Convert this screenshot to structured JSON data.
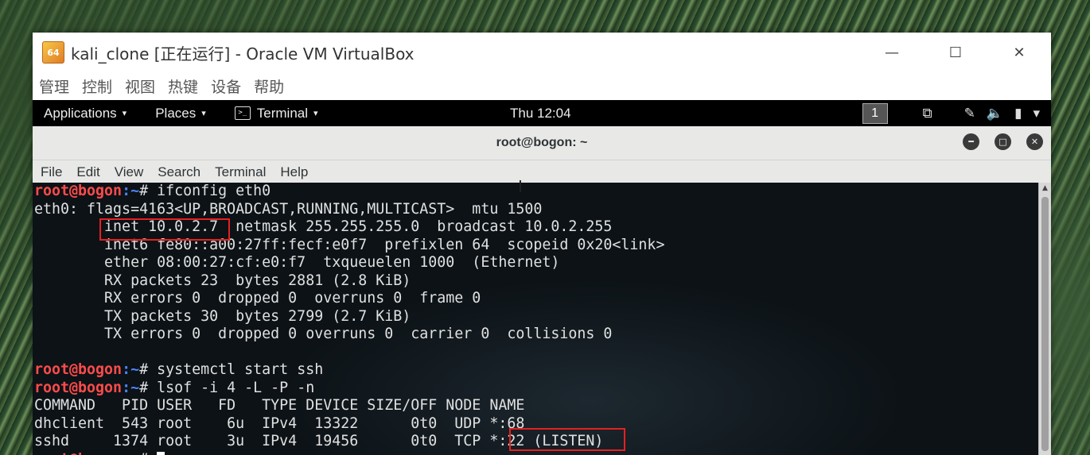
{
  "vbox": {
    "app_icon_label": "64",
    "title": "kali_clone [正在运行] - Oracle VM VirtualBox",
    "controls": {
      "minimize": "—",
      "maximize": "☐",
      "close": "✕"
    },
    "menu": [
      "管理",
      "控制",
      "视图",
      "热键",
      "设备",
      "帮助"
    ]
  },
  "gnome": {
    "applications": "Applications",
    "places": "Places",
    "terminal": "Terminal",
    "clock": "Thu 12:04",
    "workspace": "1",
    "caret": "▾"
  },
  "terminal": {
    "title": "root@bogon: ~",
    "menu": [
      "File",
      "Edit",
      "View",
      "Search",
      "Terminal",
      "Help"
    ],
    "lines": [
      {
        "user": "root@bogon",
        "path": ":~",
        "text": "# ifconfig eth0"
      },
      {
        "text": "eth0: flags=4163<UP,BROADCAST,RUNNING,MULTICAST>  mtu 1500"
      },
      {
        "text": "        inet 10.0.2.7  netmask 255.255.255.0  broadcast 10.0.2.255"
      },
      {
        "text": "        inet6 fe80::a00:27ff:fecf:e0f7  prefixlen 64  scopeid 0x20<link>"
      },
      {
        "text": "        ether 08:00:27:cf:e0:f7  txqueuelen 1000  (Ethernet)"
      },
      {
        "text": "        RX packets 23  bytes 2881 (2.8 KiB)"
      },
      {
        "text": "        RX errors 0  dropped 0  overruns 0  frame 0"
      },
      {
        "text": "        TX packets 30  bytes 2799 (2.7 KiB)"
      },
      {
        "text": "        TX errors 0  dropped 0 overruns 0  carrier 0  collisions 0"
      },
      {
        "text": ""
      },
      {
        "user": "root@bogon",
        "path": ":~",
        "text": "# systemctl start ssh"
      },
      {
        "user": "root@bogon",
        "path": ":~",
        "text": "# lsof -i 4 -L -P -n"
      },
      {
        "text": "COMMAND   PID USER   FD   TYPE DEVICE SIZE/OFF NODE NAME"
      },
      {
        "text": "dhclient  543 root    6u  IPv4  13322      0t0  UDP *:68"
      },
      {
        "text": "sshd     1374 root    3u  IPv4  19456      0t0  TCP *:22 (LISTEN)"
      },
      {
        "user": "root@bogon",
        "path": ":~",
        "text": "# ",
        "cursor": true
      }
    ]
  },
  "colors": {
    "prompt_user": "#ff4b4b",
    "prompt_path": "#4b84ff",
    "highlight": "#e62020"
  }
}
